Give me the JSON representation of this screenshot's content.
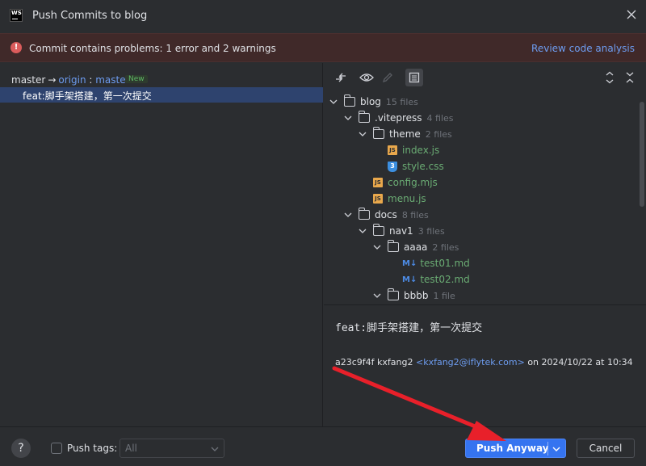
{
  "window": {
    "title": "Push Commits to blog",
    "logo_text": "WS"
  },
  "problem_bar": {
    "icon": "error-icon",
    "message": "Commit contains problems: 1 error and 2 warnings",
    "link_label": "Review code analysis"
  },
  "branch": {
    "local": "master",
    "arrow": "→",
    "remote": "origin",
    "separator": " : ",
    "remote_branch": "master",
    "badge": "New"
  },
  "commits": [
    {
      "message": "feat:脚手架搭建，第一次提交"
    }
  ],
  "tree": {
    "root": {
      "name": "blog",
      "count": "15 files"
    },
    "vitepress": {
      "name": ".vitepress",
      "count": "4 files"
    },
    "theme": {
      "name": "theme",
      "count": "2 files"
    },
    "theme_files": [
      "index.js",
      "style.css"
    ],
    "vitepress_files": [
      "config.mjs",
      "menu.js"
    ],
    "docs": {
      "name": "docs",
      "count": "8 files"
    },
    "nav1": {
      "name": "nav1",
      "count": "3 files"
    },
    "aaaa": {
      "name": "aaaa",
      "count": "2 files"
    },
    "aaaa_files": [
      "test01.md",
      "test02.md"
    ],
    "bbbb": {
      "name": "bbbb",
      "count": "1 file"
    }
  },
  "details": {
    "message": "feat:脚手架搭建，第一次提交",
    "hash": "a23c9f4f",
    "author": "kxfang2",
    "email": "<kxfang2@iflytek.com>",
    "on_text": "on 2024/10/22 at 10:34"
  },
  "footer": {
    "help": "?",
    "push_tags_label": "Push tags:",
    "tags_value": "All",
    "push_label": "Push Anyway",
    "cancel_label": "Cancel"
  },
  "colors": {
    "accent": "#3574f0",
    "error": "#db5c5c",
    "link": "#6d9cf0",
    "annotation_arrow": "#e8202a"
  }
}
